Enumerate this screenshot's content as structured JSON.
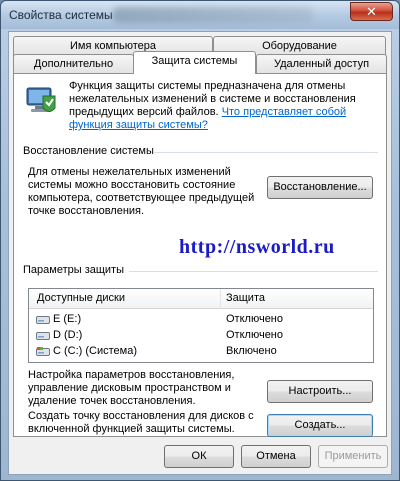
{
  "window": {
    "title": "Свойства системы",
    "close_label": "✕"
  },
  "tabs": {
    "computer_name": "Имя компьютера",
    "hardware": "Оборудование",
    "advanced": "Дополнительно",
    "protection": "Защита системы",
    "remote": "Удаленный доступ"
  },
  "intro": {
    "text": "Функция защиты системы предназначена для отмены нежелательных изменений в системе и восстановления предыдущих версий файлов.",
    "link": "Что представляет собой функция защиты системы?"
  },
  "restore": {
    "group_title": "Восстановление системы",
    "description": "Для отмены нежелательных изменений системы можно восстановить состояние компьютера, соответствующее предыдущей точке восстановления.",
    "button": "Восстановление..."
  },
  "watermark": "http://nsworld.ru",
  "protection": {
    "group_title": "Параметры защиты",
    "columns": [
      "Доступные диски",
      "Защита"
    ],
    "drives": [
      {
        "name": "E (E:)",
        "status": "Отключено",
        "icon": "drive-icon"
      },
      {
        "name": "D (D:)",
        "status": "Отключено",
        "icon": "drive-icon"
      },
      {
        "name": "C (C:) (Система)",
        "status": "Включено",
        "icon": "system-drive-icon"
      }
    ],
    "configure_text": "Настройка параметров восстановления, управление дисковым пространством и удаление точек восстановления.",
    "configure_button": "Настроить...",
    "create_text": "Создать точку восстановления для дисков с включенной функцией защиты системы.",
    "create_button": "Создать..."
  },
  "footer": {
    "ok": "ОК",
    "cancel": "Отмена",
    "apply": "Применить"
  }
}
